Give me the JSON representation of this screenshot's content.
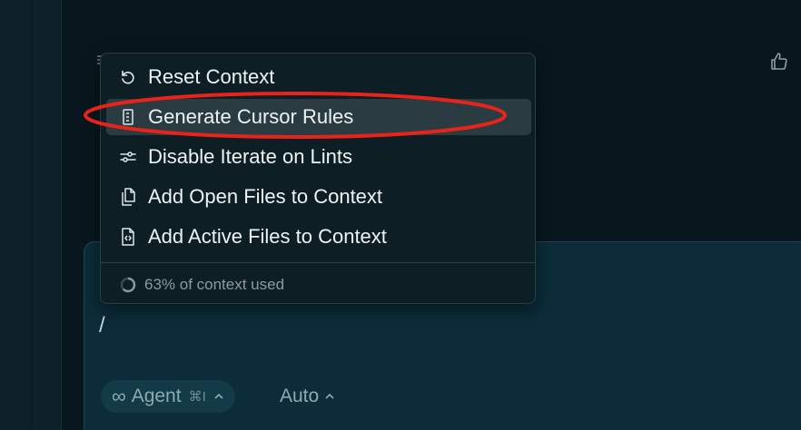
{
  "menu": {
    "items": [
      {
        "label": "Reset Context",
        "icon": "reset-icon"
      },
      {
        "label": "Generate Cursor Rules",
        "icon": "rules-file-icon"
      },
      {
        "label": "Disable Iterate on Lints",
        "icon": "sliders-icon"
      },
      {
        "label": "Add Open Files to Context",
        "icon": "files-icon"
      },
      {
        "label": "Add Active Files to Context",
        "icon": "code-file-icon"
      }
    ],
    "highlighted_index": 1,
    "context_usage_text": "63% of context used",
    "context_usage_fraction": 0.63
  },
  "composer": {
    "input_value": "/",
    "agent_chip": {
      "label": "Agent",
      "shortcut": "⌘I",
      "icon": "infinity-icon"
    },
    "model_chip": {
      "label": "Auto"
    }
  },
  "colors": {
    "annotation": "#e8231a",
    "highlight": "#2a3c41",
    "popup_bg": "#0d1f25"
  }
}
